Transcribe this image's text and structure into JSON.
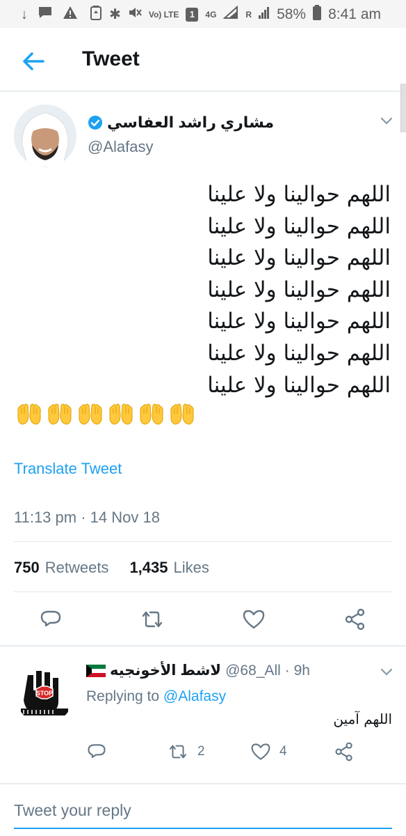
{
  "status_bar": {
    "battery_pct": "58%",
    "time": "8:41 am",
    "volte_label": "Vo) LTE",
    "sim_label": "1",
    "network_label": "4G",
    "roaming_label": "R"
  },
  "header": {
    "title": "Tweet"
  },
  "tweet": {
    "author_name": "مشاري راشد العفاسي",
    "author_handle": "@Alafasy",
    "lines": [
      "اللهم حوالينا ولا علينا",
      "اللهم حوالينا ولا علينا",
      "اللهم حوالينا ولا علينا",
      "اللهم حوالينا ولا علينا",
      "اللهم حوالينا ولا علينا",
      "اللهم حوالينا ولا علينا",
      "اللهم حوالينا ولا علينا"
    ],
    "emoji_count": 6,
    "translate_label": "Translate Tweet",
    "timestamp": "11:13 pm · 14 Nov 18",
    "retweets_count": "750",
    "retweets_label": "Retweets",
    "likes_count": "1,435",
    "likes_label": "Likes"
  },
  "reply": {
    "author_name": "لاشط الأخونجيه",
    "author_handle": "@68_All",
    "time": "· 9h",
    "avatar_sign": "STOP",
    "replying_prefix": "Replying to",
    "replying_to": "@Alafasy",
    "text": "اللهم آمين",
    "retweet_count": "2",
    "like_count": "4"
  },
  "compose": {
    "placeholder": "Tweet your reply"
  },
  "colors": {
    "accent": "#1da1f2",
    "secondary_text": "#657786",
    "divider": "#e1e8ed"
  }
}
